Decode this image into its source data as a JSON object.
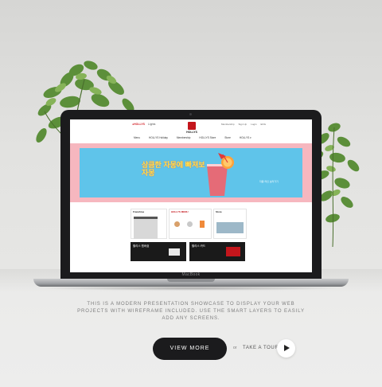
{
  "site": {
    "brand": "HOLLYS",
    "top_left_links": [
      "●HOLLYS",
      "Lights"
    ],
    "top_links": [
      "Membership",
      "Sign Up",
      "Login",
      "ENG"
    ],
    "nav": [
      "Menu",
      "HOLLYS Holiday",
      "Membership",
      "HOLLYS Store",
      "Store",
      "HOLLYS ▾"
    ],
    "banner_title": "상큼한 자몽에 빠져보자몽",
    "banner_sub": "자몽 라인 보러가기",
    "cards": [
      "Franchise",
      "HOLLYS MENU",
      "Store"
    ],
    "promos": [
      "할리스 멤버쉽",
      "할리스 카드"
    ]
  },
  "laptop_label": "MacBook",
  "caption": "THIS IS A MODERN PRESENTATION SHOWCASE TO DISPLAY YOUR WEB PROJECTS WITH WIREFRAME INCLUDED. USE THE SMART LAYERS TO EASILY ADD ANY SCREENS.",
  "buttons": {
    "view_more": "VIEW MORE",
    "or": "or",
    "take_tour": "TAKE A TOUR"
  },
  "colors": {
    "background": "#e4e4e2",
    "button_dark": "#1b1b1d",
    "brand_red": "#c4161c",
    "banner_blue": "#5fc4ea",
    "banner_pink": "#f6b7bf"
  },
  "icons": [
    "plant-left",
    "plant-right",
    "play-icon"
  ]
}
